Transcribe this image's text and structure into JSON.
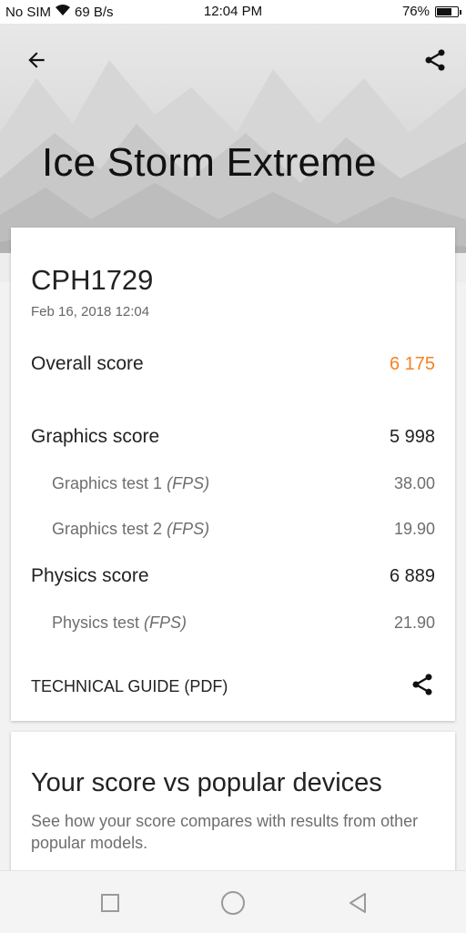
{
  "status_bar": {
    "carrier": "No SIM",
    "net_speed": "69 B/s",
    "time": "12:04 PM",
    "battery": "76%",
    "battery_level": 0.76
  },
  "header": {
    "title": "Ice Storm Extreme",
    "back_icon": "arrow-left-icon",
    "share_icon": "share-icon"
  },
  "result": {
    "device": "CPH1729",
    "date": "Feb 16, 2018 12:04",
    "overall_label": "Overall score",
    "overall_value": "6 175",
    "graphics_label": "Graphics score",
    "graphics_value": "5 998",
    "gt1_label": "Graphics test 1",
    "gt1_unit": "(FPS)",
    "gt1_value": "38.00",
    "gt2_label": "Graphics test 2",
    "gt2_unit": "(FPS)",
    "gt2_value": "19.90",
    "physics_label": "Physics score",
    "physics_value": "6 889",
    "pt_label": "Physics test",
    "pt_unit": "(FPS)",
    "pt_value": "21.90",
    "tech_guide_label": "TECHNICAL GUIDE (PDF)"
  },
  "compare": {
    "title": "Your score vs popular devices",
    "description": "See how your score compares with results from other popular models."
  },
  "nav": {
    "recent_icon": "square-icon",
    "home_icon": "circle-icon",
    "back_icon": "triangle-back-icon"
  },
  "colors": {
    "accent": "#f58220",
    "text": "#222222",
    "muted": "#6e6e6e"
  }
}
